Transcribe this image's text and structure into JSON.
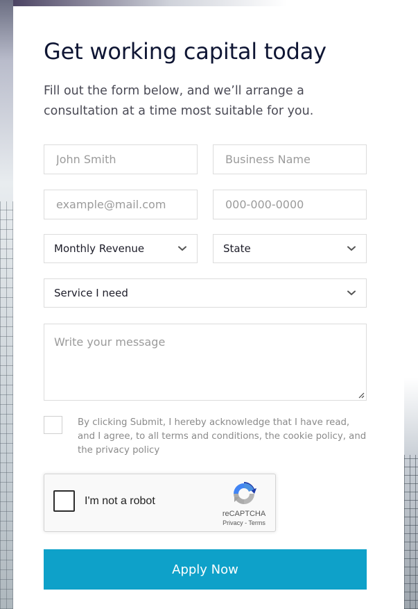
{
  "form": {
    "title": "Get working capital today",
    "subtitle": "Fill out the form below, and we’ll arrange a consultation at a time most suitable for you.",
    "name_placeholder": "John Smith",
    "business_placeholder": "Business Name",
    "email_placeholder": "example@mail.com",
    "phone_placeholder": "000-000-0000",
    "revenue_select": "Monthly Revenue",
    "state_select": "State",
    "service_select": "Service I need",
    "message_placeholder": "Write your message",
    "consent_text": "By clicking Submit, I hereby acknowledge that I have read, and I agree, to all terms and conditions, the cookie policy, and the privacy policy",
    "submit_label": "Apply Now"
  },
  "recaptcha": {
    "label": "I'm not a robot",
    "brand": "reCAPTCHA",
    "links": "Privacy - Terms",
    "icon": "recaptcha-logo"
  },
  "icons": {
    "select_arrow": "chevron-down-icon",
    "resize": "resize-handle-icon"
  },
  "colors": {
    "accent": "#0ea1c9",
    "title": "#0f1634",
    "border": "#dcdcdc",
    "placeholder": "#9b9b9b"
  }
}
